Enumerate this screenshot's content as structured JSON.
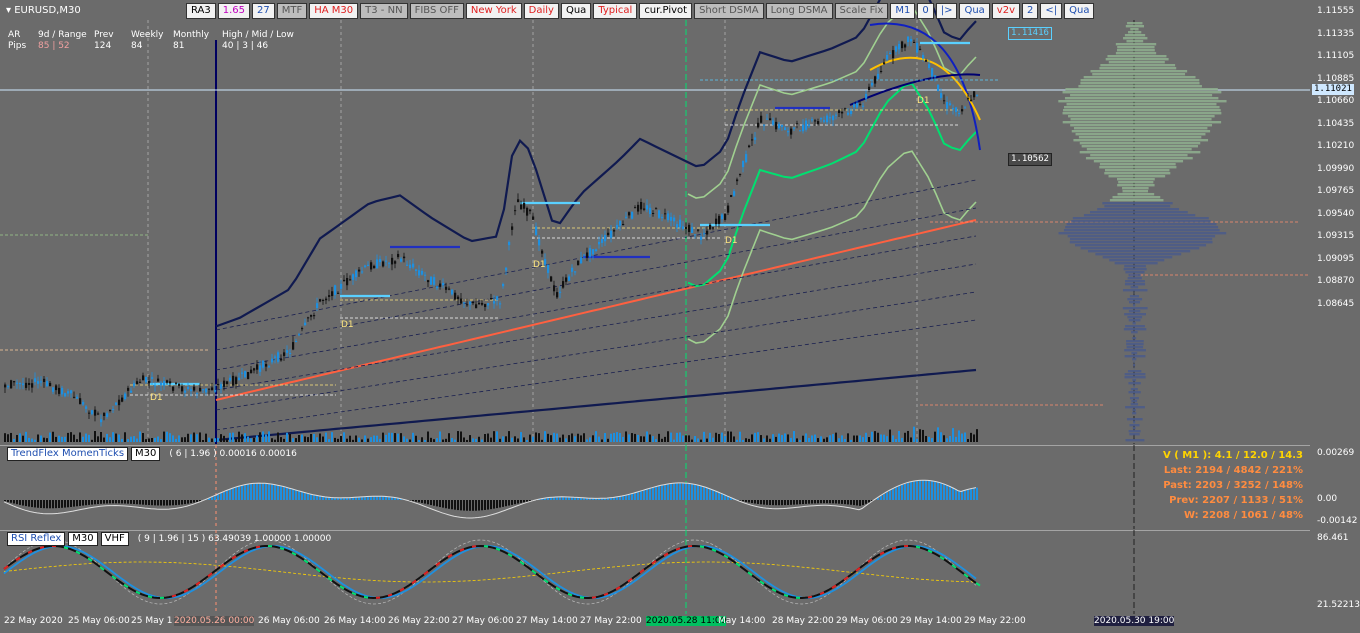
{
  "symbol": "EURUSD,M30",
  "toolbar": [
    {
      "label": "RA3",
      "color": "#000"
    },
    {
      "label": "1.65",
      "color": "#c000c0"
    },
    {
      "label": "27",
      "color": "#1f4fb0"
    },
    {
      "label": "MTF",
      "color": "#555"
    },
    {
      "label": "HA M30",
      "color": "#e02020"
    },
    {
      "label": "T3 - NN",
      "color": "#555"
    },
    {
      "label": "FIBS OFF",
      "color": "#555"
    },
    {
      "label": "New York",
      "color": "#e02020"
    },
    {
      "label": "Daily",
      "color": "#e02020"
    },
    {
      "label": "Qua",
      "color": "#000"
    },
    {
      "label": "Typical",
      "color": "#e02020"
    },
    {
      "label": "cur.Pivot",
      "color": "#000"
    },
    {
      "label": "Short DSMA",
      "color": "#555"
    },
    {
      "label": "Long DSMA",
      "color": "#555"
    },
    {
      "label": "Scale Fix",
      "color": "#555"
    },
    {
      "label": "M1",
      "color": "#1f4fb0"
    },
    {
      "label": "0",
      "color": "#1f4fb0"
    },
    {
      "label": "|>",
      "color": "#1f4fb0"
    },
    {
      "label": "Qua",
      "color": "#1f4fb0"
    },
    {
      "label": "v2v",
      "color": "#e02020"
    },
    {
      "label": "2",
      "color": "#1f4fb0"
    },
    {
      "label": "<|",
      "color": "#1f4fb0"
    },
    {
      "label": "Qua",
      "color": "#1f4fb0"
    }
  ],
  "info": {
    "ar": "AR",
    "pips": "Pips",
    "range_hdr": "9d / Range",
    "range_val": "85 | 52",
    "prev_hdr": "Prev",
    "prev_val": "124",
    "weekly_hdr": "Weekly",
    "weekly_val": "84",
    "monthly_hdr": "Monthly",
    "monthly_val": "81",
    "hml_hdr": "High / Mid / Low",
    "hml_val": "40  |  3  |  46"
  },
  "price_axis": [
    "1.11555",
    "1.11335",
    "1.11105",
    "1.10885",
    "1.10660",
    "1.10435",
    "1.10210",
    "1.09990",
    "1.09765",
    "1.09540",
    "1.09315",
    "1.09095",
    "1.08870",
    "1.08645"
  ],
  "current_price": "1.11021",
  "price_tags": {
    "upper": "1.11416",
    "lower": "1.10562"
  },
  "d1_labels": [
    "D1",
    "D1",
    "D1",
    "D1",
    "D1"
  ],
  "indicator1": {
    "name": "TrendFlex MomenTicks",
    "tf": "M30",
    "params": "( 6 | 1.96 ) 0.00016 0.00016",
    "axis": [
      "0.00269",
      "0.00",
      "-0.00142"
    ]
  },
  "stats": {
    "v": "V ( M1 ): 4.1 / 12.0 / 14.3",
    "last": "Last: 2194 / 4842 / 221%",
    "past": "Past: 2203 / 3252 / 148%",
    "prev": "Prev: 2207 / 1133 / 51%",
    "w": "W: 2208 / 1061 / 48%"
  },
  "indicator2": {
    "name": "RSI Reflex",
    "tf": "M30",
    "extra": "VHF",
    "params": "( 9 | 1.96 | 15 ) 63.49039 1.00000 1.00000",
    "axis": [
      "86.461",
      "21.52213"
    ]
  },
  "time_axis": [
    "22 May 2020",
    "25 May 06:00",
    "25 May 1",
    "2020.05.26 00:00",
    "26 May 06:00",
    "26 May 14:00",
    "26 May 22:00",
    "27 May 06:00",
    "27 May 14:00",
    "27 May 22:00",
    "2020.05.28 11:00",
    "May 14:00",
    "28 May 22:00",
    "29 May 06:00",
    "29 May 14:00",
    "29 May 22:00",
    "2020.05.30 19:00"
  ],
  "colors": {
    "bg": "#6b6b6b",
    "bull": "#1e90e0",
    "bear": "#000000",
    "current": "#cfe8ff",
    "ema": "#ff6040",
    "band_green": "#00e070"
  }
}
